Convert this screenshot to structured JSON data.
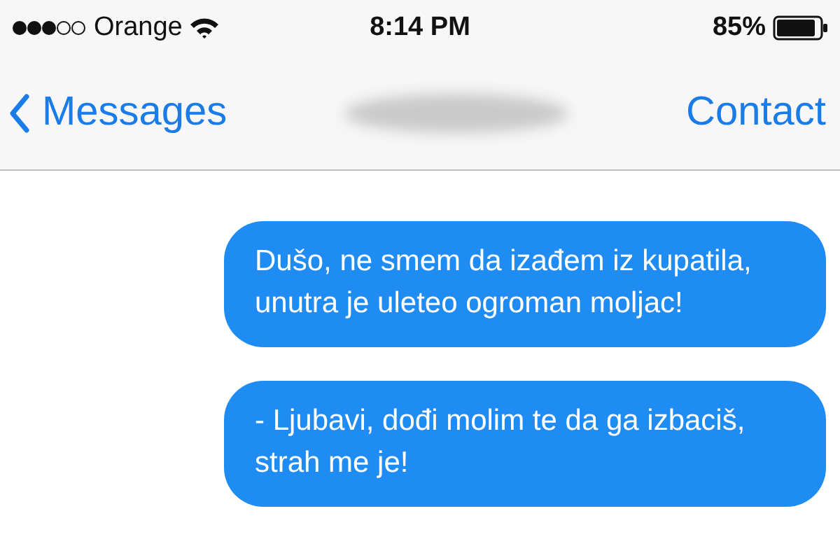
{
  "status_bar": {
    "carrier": "Orange",
    "time": "8:14 PM",
    "battery": "85%"
  },
  "nav_bar": {
    "back": "Messages",
    "action": "Contact"
  },
  "messages": [
    {
      "text": "Dušo, ne smem da izađem iz kupatila, unutra je uleteo ogroman moljac!",
      "sent": true
    },
    {
      "text": "- Ljubavi, dođi molim te da ga izbaciš, strah me je!",
      "sent": true
    }
  ]
}
